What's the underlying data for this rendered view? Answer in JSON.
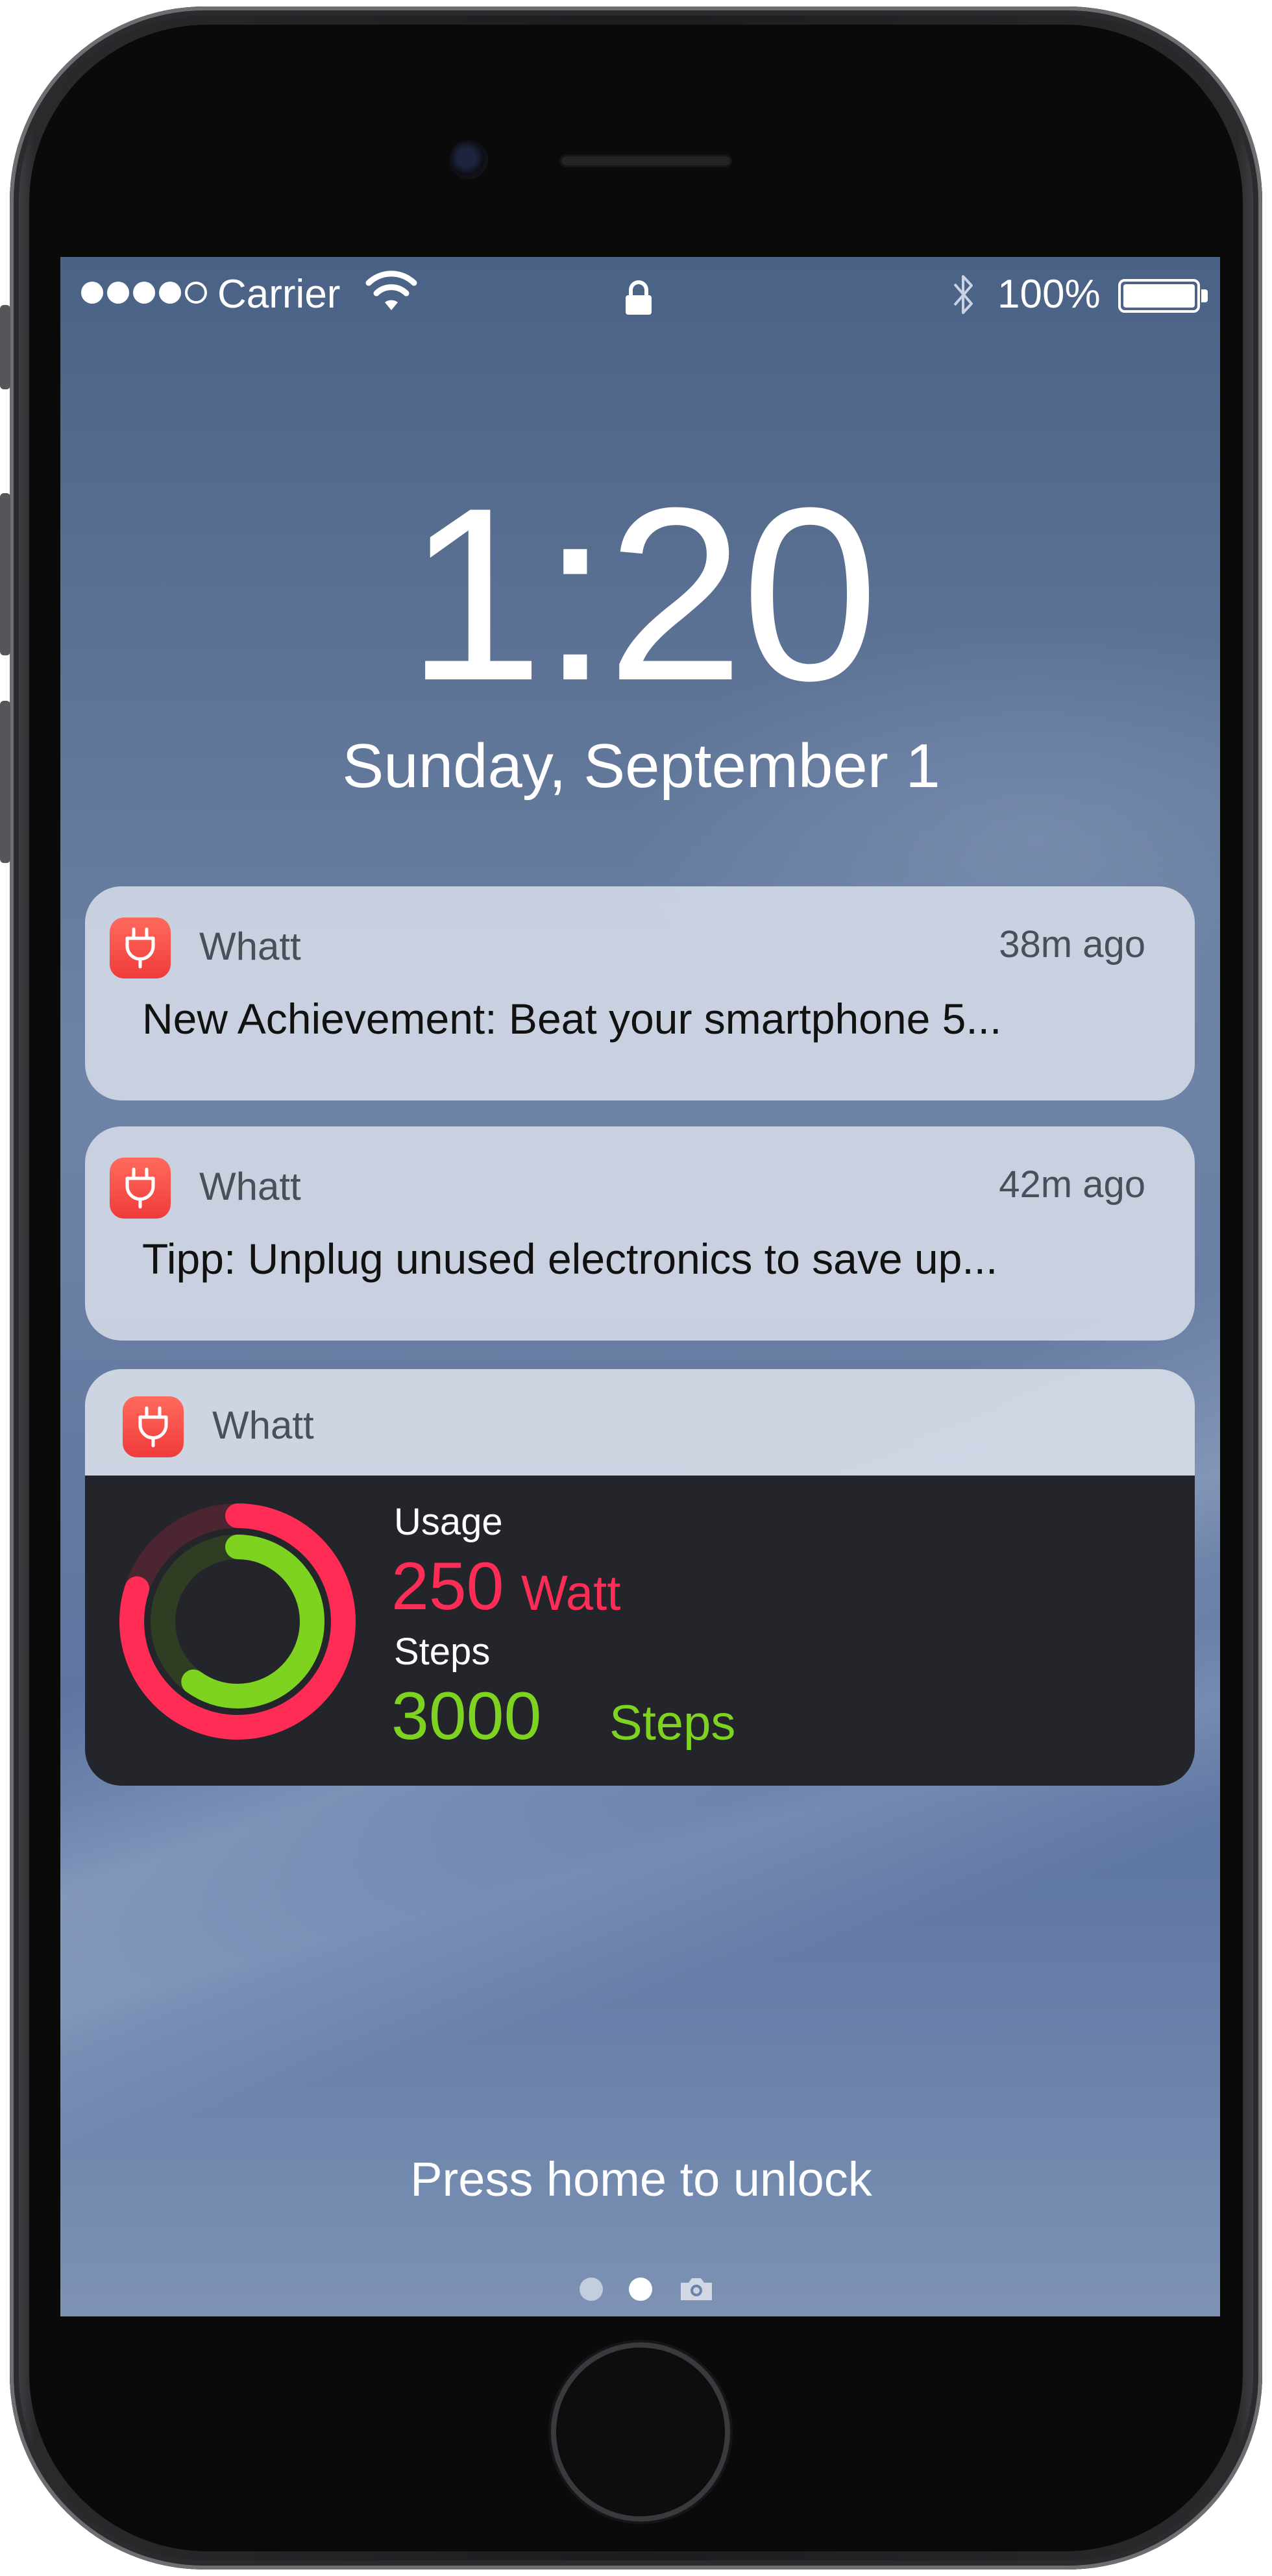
{
  "status_bar": {
    "carrier": "Carrier",
    "signal_bars_filled": 4,
    "signal_bars_total": 5,
    "battery_percent": "100%",
    "icons": [
      "wifi-icon",
      "lock-icon",
      "bluetooth-icon",
      "battery-icon"
    ]
  },
  "lockscreen": {
    "time": "1:20",
    "date": "Sunday, September 1",
    "unlock_hint": "Press home to unlock",
    "page_count": 2,
    "active_page": 2
  },
  "notifications": [
    {
      "app_name": "Whatt",
      "time_ago": "38m ago",
      "message": "New Achievement: Beat your smartphone 5...",
      "icon": "plug-icon"
    },
    {
      "app_name": "Whatt",
      "time_ago": "42m ago",
      "message": "Tipp: Unplug unused electronics to save up...",
      "icon": "plug-icon"
    }
  ],
  "widget": {
    "app_name": "Whatt",
    "icon": "plug-icon",
    "usage_label": "Usage",
    "usage_value": "250",
    "usage_unit": "Watt",
    "steps_label": "Steps",
    "steps_value": "3000",
    "steps_unit": "Steps",
    "usage_ring_fraction": 0.8,
    "steps_ring_fraction": 0.6
  },
  "colors": {
    "usage": "#ff2d55",
    "steps": "#7ed321",
    "app_icon": "#f4453f"
  }
}
